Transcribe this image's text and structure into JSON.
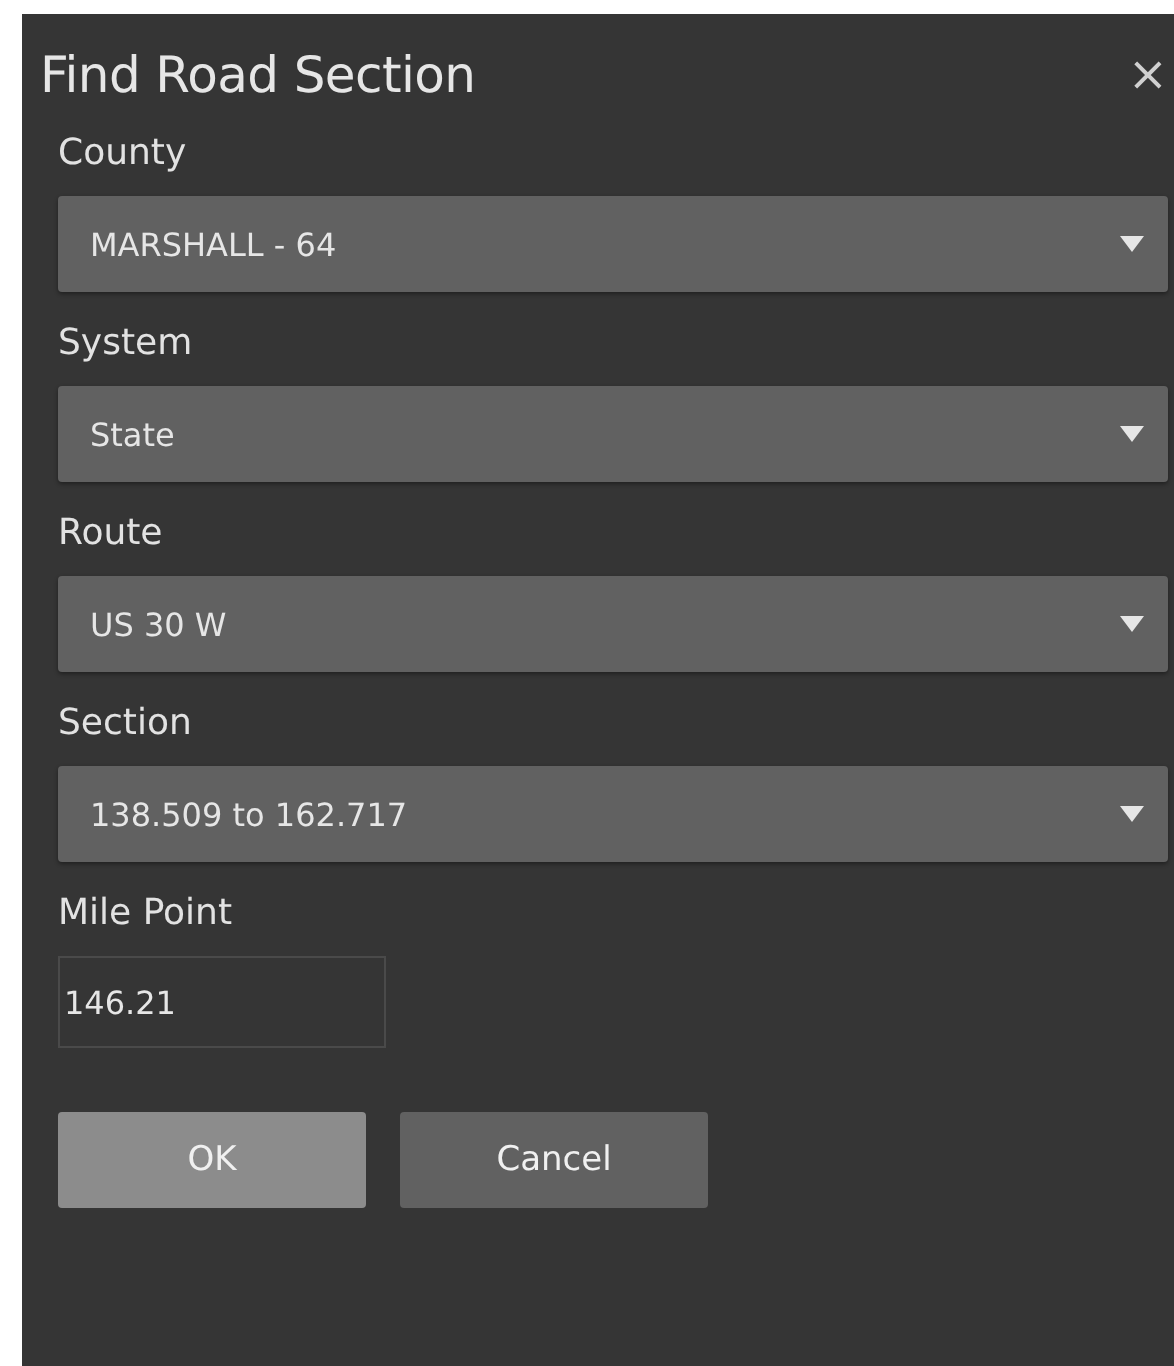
{
  "dialog": {
    "title": "Find Road Section",
    "close": "×"
  },
  "fields": [
    {
      "kind": "select",
      "label": "County",
      "value": "MARSHALL - 64"
    },
    {
      "kind": "select",
      "label": "System",
      "value": "State"
    },
    {
      "kind": "select",
      "label": "Route",
      "value": "US 30 W"
    },
    {
      "kind": "select",
      "label": "Section",
      "value": "138.509 to 162.717"
    },
    {
      "kind": "input",
      "label": "Mile Point",
      "value": "146.21"
    }
  ],
  "buttons": [
    {
      "label": "OK",
      "kind": "primary"
    },
    {
      "label": "Cancel",
      "kind": "secondary"
    }
  ]
}
